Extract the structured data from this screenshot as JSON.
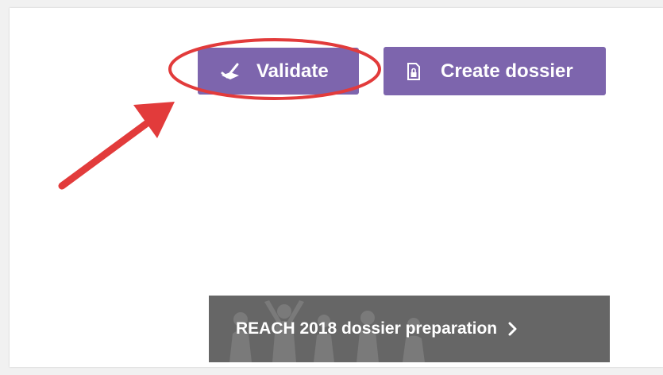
{
  "toolbar": {
    "validate_label": "Validate",
    "create_dossier_label": "Create dossier"
  },
  "banner": {
    "label": "REACH 2018 dossier preparation"
  },
  "colors": {
    "button_purple": "#7d65ad",
    "banner_gray": "#666666",
    "annotation_red": "#e23b3b"
  },
  "icons": {
    "validate": "checkmark-stamp-icon",
    "create_dossier": "document-lock-icon",
    "banner_chevron": "chevron-right-icon"
  }
}
